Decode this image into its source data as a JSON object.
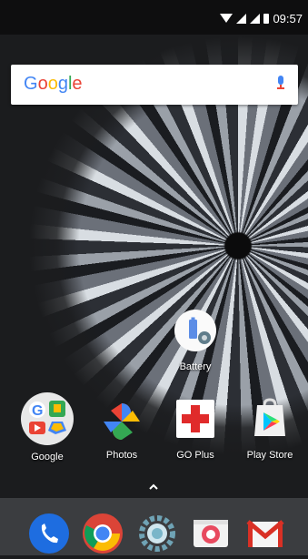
{
  "status_bar": {
    "time": "09:57"
  },
  "search": {
    "logo_text": "Google"
  },
  "apps": {
    "battery": {
      "label": "Battery"
    },
    "google": {
      "label": "Google"
    },
    "photos": {
      "label": "Photos"
    },
    "go_plus": {
      "label": "GO Plus"
    },
    "play_store": {
      "label": "Play Store"
    }
  },
  "dock": {
    "items": [
      "phone-icon",
      "chrome-icon",
      "camera-settings-icon",
      "camera-icon",
      "gmail-icon"
    ]
  },
  "colors": {
    "google_blue": "#4285f4",
    "google_red": "#ea4335",
    "google_yellow": "#fbbc05",
    "google_green": "#34a853"
  }
}
